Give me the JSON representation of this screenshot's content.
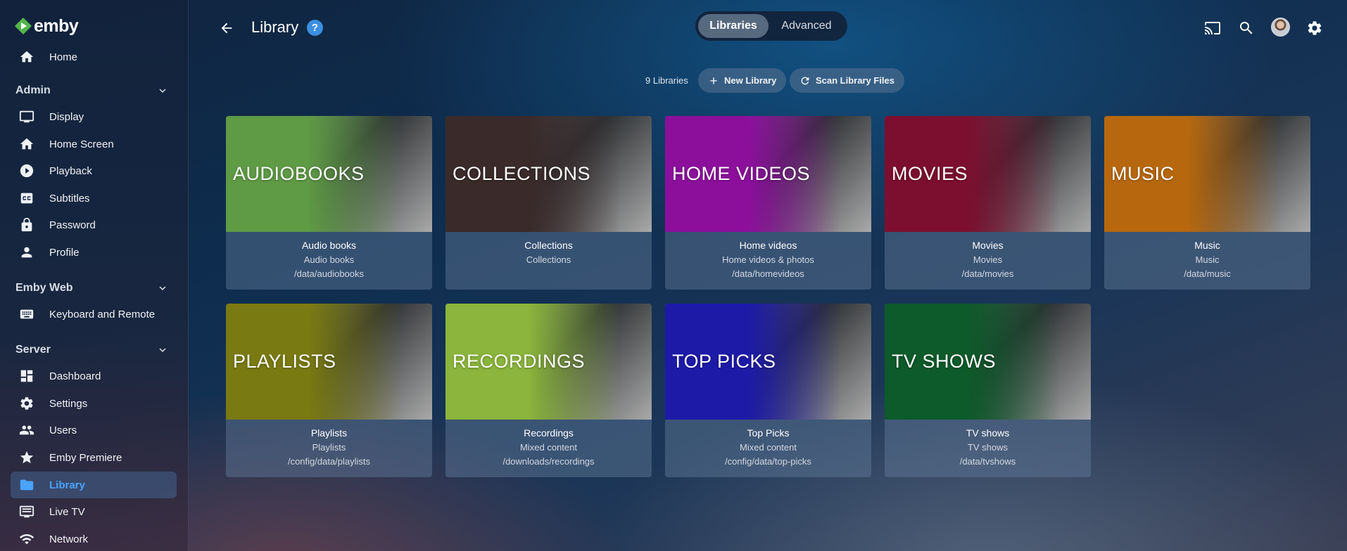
{
  "brand": {
    "name": "emby"
  },
  "nav": {
    "home": "Home",
    "admin_section": "Admin",
    "admin_items": [
      "Display",
      "Home Screen",
      "Playback",
      "Subtitles",
      "Password",
      "Profile"
    ],
    "emby_web_section": "Emby Web",
    "emby_web_items": [
      "Keyboard and Remote"
    ],
    "server_section": "Server",
    "server_items": [
      "Dashboard",
      "Settings",
      "Users",
      "Emby Premiere",
      "Library",
      "Live TV",
      "Network"
    ],
    "active_item": "Library"
  },
  "header": {
    "title": "Library",
    "help": "?",
    "tabs": [
      "Libraries",
      "Advanced"
    ],
    "active_tab": "Libraries",
    "icons": [
      "cast-icon",
      "search-icon",
      "avatar",
      "gear-icon"
    ]
  },
  "toolbar": {
    "count": "9 Libraries",
    "new_library": "New Library",
    "scan_library_files": "Scan Library Files"
  },
  "libraries": [
    {
      "overlay": "AUDIOBOOKS",
      "name": "Audio books",
      "type": "Audio books",
      "path": "/data/audiobooks",
      "color": "#5f9a45"
    },
    {
      "overlay": "COLLECTIONS",
      "name": "Collections",
      "type": "Collections",
      "path": "",
      "color": "#3a2a2a"
    },
    {
      "overlay": "HOME VIDEOS",
      "name": "Home videos",
      "type": "Home videos & photos",
      "path": "/data/homevideos",
      "color": "#8c0f9c"
    },
    {
      "overlay": "MOVIES",
      "name": "Movies",
      "type": "Movies",
      "path": "/data/movies",
      "color": "#7c0f30"
    },
    {
      "overlay": "MUSIC",
      "name": "Music",
      "type": "Music",
      "path": "/data/music",
      "color": "#b7680e"
    },
    {
      "overlay": "PLAYLISTS",
      "name": "Playlists",
      "type": "Playlists",
      "path": "/config/data/playlists",
      "color": "#7a7a12"
    },
    {
      "overlay": "RECORDINGS",
      "name": "Recordings",
      "type": "Mixed content",
      "path": "/downloads/recordings",
      "color": "#8bb53c"
    },
    {
      "overlay": "TOP PICKS",
      "name": "Top Picks",
      "type": "Mixed content",
      "path": "/config/data/top-picks",
      "color": "#1d1aa8"
    },
    {
      "overlay": "TV SHOWS",
      "name": "TV shows",
      "type": "TV shows",
      "path": "/data/tvshows",
      "color": "#0d5a2a"
    }
  ]
}
